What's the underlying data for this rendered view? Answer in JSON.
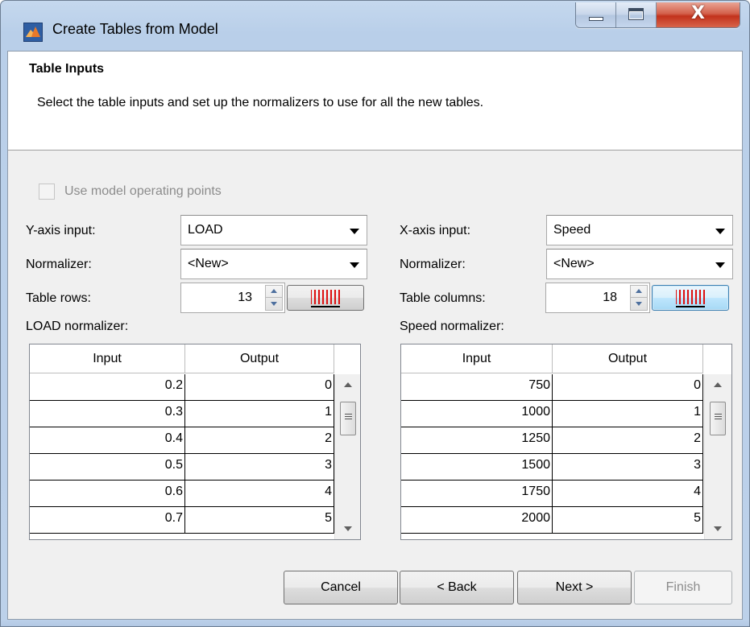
{
  "window": {
    "title": "Create Tables from Model",
    "app_icon": "matlab-icon",
    "caption_buttons": {
      "minimize": "minimize-icon",
      "maximize": "maximize-icon",
      "close": "close-icon",
      "close_glyph": "X"
    }
  },
  "header": {
    "title": "Table Inputs",
    "description": "Select the table inputs and set up the normalizers to use for all the new tables."
  },
  "form": {
    "use_operating_points_label": "Use model operating points",
    "use_operating_points_checked": false,
    "y_axis_label": "Y-axis input:",
    "y_axis_value": "LOAD",
    "x_axis_label": "X-axis input:",
    "x_axis_value": "Speed",
    "y_normalizer_label": "Normalizer:",
    "y_normalizer_value": "<New>",
    "x_normalizer_label": "Normalizer:",
    "x_normalizer_value": "<New>",
    "rows_label": "Table rows:",
    "rows_value": "13",
    "columns_label": "Table columns:",
    "columns_value": "18",
    "breakpoint_icon": "breakpoint-spacing-icon"
  },
  "left_table": {
    "caption": "LOAD normalizer:",
    "headers": [
      "Input",
      "Output"
    ],
    "rows": [
      [
        "0.2",
        "0"
      ],
      [
        "0.3",
        "1"
      ],
      [
        "0.4",
        "2"
      ],
      [
        "0.5",
        "3"
      ],
      [
        "0.6",
        "4"
      ],
      [
        "0.7",
        "5"
      ]
    ]
  },
  "right_table": {
    "caption": "Speed normalizer:",
    "headers": [
      "Input",
      "Output"
    ],
    "rows": [
      [
        "750",
        "0"
      ],
      [
        "1000",
        "1"
      ],
      [
        "1250",
        "2"
      ],
      [
        "1500",
        "3"
      ],
      [
        "1750",
        "4"
      ],
      [
        "2000",
        "5"
      ]
    ]
  },
  "buttons": {
    "cancel": "Cancel",
    "back": "< Back",
    "next": "Next >",
    "finish": "Finish"
  },
  "colors": {
    "frame": "#bcd1ea",
    "close_button": "#c2321c",
    "panel": "#f0f0f0",
    "breakpoint_bars": "#dd1111"
  }
}
